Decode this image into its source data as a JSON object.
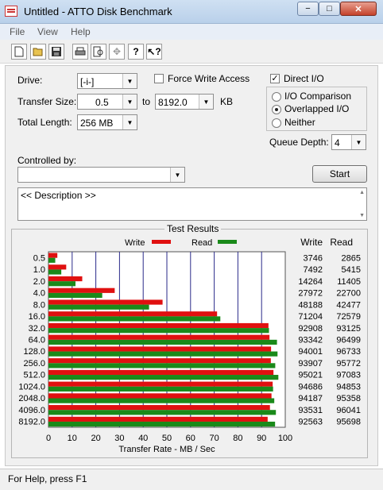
{
  "window": {
    "title": "Untitled - ATTO Disk Benchmark",
    "icon": "atto-app-icon",
    "controls": [
      "−",
      "□",
      "✕"
    ]
  },
  "menu": [
    "File",
    "View",
    "Help"
  ],
  "toolbar": {
    "icons": [
      "new-icon",
      "open-icon",
      "save-icon",
      "print-icon",
      "print-preview-icon",
      "move-icon",
      "help-icon",
      "context-help-icon"
    ]
  },
  "settings": {
    "drive_label": "Drive:",
    "drive_value": "[-i-]",
    "force_write_label": "Force Write Access",
    "force_write_checked": false,
    "direct_io_label": "Direct I/O",
    "direct_io_checked": true,
    "transfer_size_label": "Transfer Size:",
    "transfer_from": "0.5",
    "to_label": "to",
    "transfer_to": "8192.0",
    "kb_label": "KB",
    "total_length_label": "Total Length:",
    "total_length_value": "256 MB",
    "io_options": [
      {
        "label": "I/O Comparison",
        "selected": false
      },
      {
        "label": "Overlapped I/O",
        "selected": true
      },
      {
        "label": "Neither",
        "selected": false
      }
    ],
    "queue_depth_label": "Queue Depth:",
    "queue_depth_value": "4",
    "controlled_by_label": "Controlled by:",
    "controlled_by_value": "",
    "start_label": "Start",
    "description": "<< Description >>"
  },
  "results": {
    "group_title": "Test Results",
    "write_column": "Write",
    "read_column": "Read"
  },
  "chart_data": {
    "type": "bar",
    "orientation": "horizontal",
    "categories": [
      "0.5",
      "1.0",
      "2.0",
      "4.0",
      "8.0",
      "16.0",
      "32.0",
      "64.0",
      "128.0",
      "256.0",
      "512.0",
      "1024.0",
      "2048.0",
      "4096.0",
      "8192.0"
    ],
    "series": [
      {
        "name": "Write",
        "color": "#e01010",
        "values": [
          3746,
          7492,
          14264,
          27972,
          48188,
          71204,
          92908,
          93342,
          94001,
          93907,
          95021,
          94686,
          94187,
          93531,
          92563
        ]
      },
      {
        "name": "Read",
        "color": "#1a8a1a",
        "values": [
          2865,
          5415,
          11405,
          22700,
          42477,
          72579,
          93125,
          96499,
          96733,
          95772,
          97083,
          94853,
          95358,
          96041,
          95698
        ]
      }
    ],
    "x_ticks": [
      "0",
      "10",
      "20",
      "30",
      "40",
      "50",
      "60",
      "70",
      "80",
      "90",
      "100"
    ],
    "xlim": [
      0,
      100
    ],
    "xlabel": "Transfer Rate - MB / Sec",
    "value_units": "KB/s",
    "grid": true,
    "legend": "top"
  },
  "status": {
    "text": "For Help, press F1"
  }
}
